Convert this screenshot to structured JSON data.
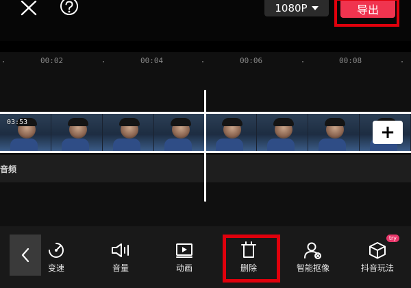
{
  "top_bar": {
    "close_icon": "close-icon",
    "help_icon": "help-icon",
    "resolution_label": "1080P",
    "export_label": "导出",
    "export_color": "#f0344f",
    "highlight_color": "#e0000c"
  },
  "timeline": {
    "ticks": [
      "00:02",
      "00:04",
      "00:06",
      "00:08"
    ],
    "clip_duration": "03:53",
    "add_clip_label": "+",
    "audio_label": "音频"
  },
  "toolbar": {
    "back_icon": "chevron-left-icon",
    "tools": [
      {
        "label": "变速",
        "icon": "speed-icon"
      },
      {
        "label": "音量",
        "icon": "volume-icon"
      },
      {
        "label": "动画",
        "icon": "animation-icon"
      },
      {
        "label": "删除",
        "icon": "delete-icon"
      },
      {
        "label": "智能抠像",
        "icon": "smart-cutout-icon"
      },
      {
        "label": "抖音玩法",
        "icon": "douyin-effects-icon",
        "badge": "try"
      }
    ]
  }
}
